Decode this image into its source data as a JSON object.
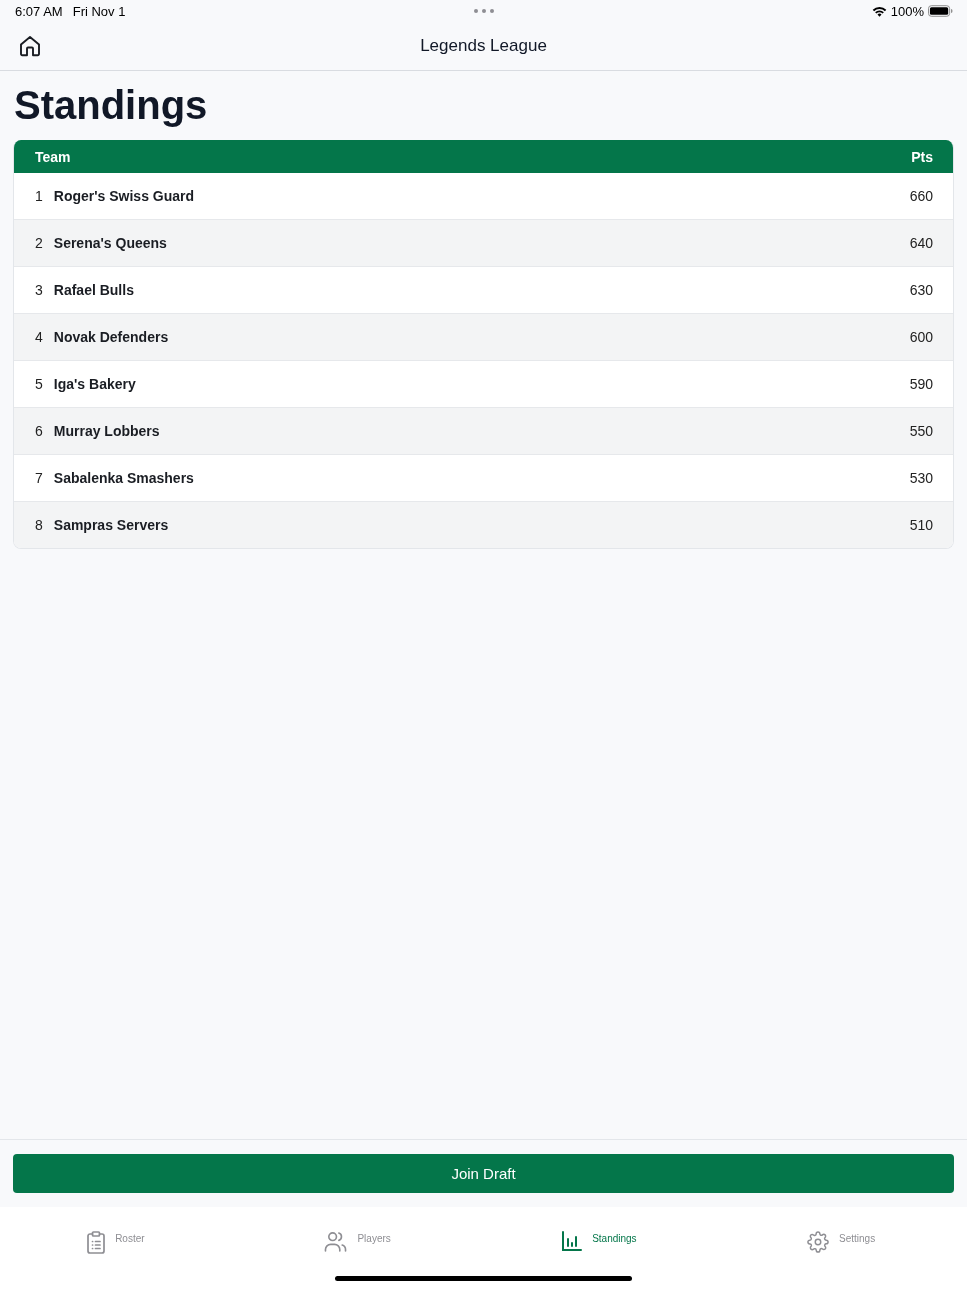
{
  "status_bar": {
    "time": "6:07 AM",
    "date": "Fri Nov 1",
    "battery": "100%"
  },
  "nav_bar": {
    "title": "Legends League"
  },
  "page_title": "Standings",
  "table": {
    "columns": [
      "Team",
      "Pts"
    ],
    "rows": [
      {
        "rank": "1",
        "team": "Roger's Swiss Guard",
        "points": "660"
      },
      {
        "rank": "2",
        "team": "Serena's Queens",
        "points": "640"
      },
      {
        "rank": "3",
        "team": "Rafael Bulls",
        "points": "630"
      },
      {
        "rank": "4",
        "team": "Novak Defenders",
        "points": "600"
      },
      {
        "rank": "5",
        "team": "Iga's Bakery",
        "points": "590"
      },
      {
        "rank": "6",
        "team": "Murray Lobbers",
        "points": "550"
      },
      {
        "rank": "7",
        "team": "Sabalenka Smashers",
        "points": "530"
      },
      {
        "rank": "8",
        "team": "Sampras Servers",
        "points": "510"
      }
    ]
  },
  "primary_button": {
    "label": "Join Draft"
  },
  "tab_bar": {
    "tabs": [
      {
        "label": "Roster",
        "kind": "clipboard",
        "selected": false
      },
      {
        "label": "Players",
        "kind": "people",
        "selected": false
      },
      {
        "label": "Standings",
        "kind": "chart",
        "selected": true
      },
      {
        "label": "Settings",
        "kind": "gear",
        "selected": false
      }
    ]
  }
}
